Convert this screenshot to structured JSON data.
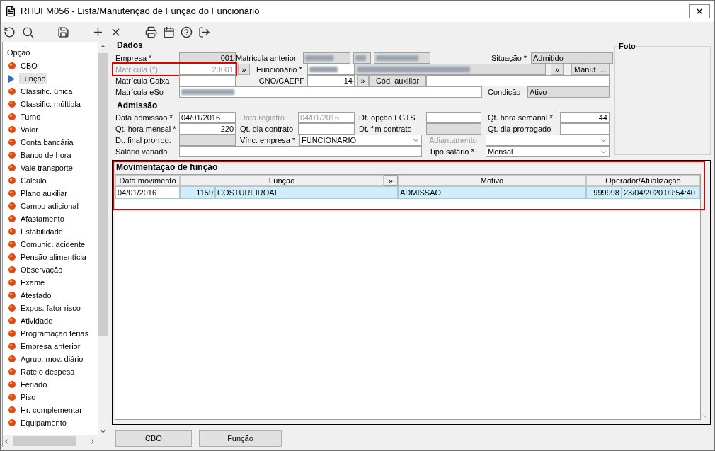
{
  "window": {
    "title": "RHUFM056 - Lista/Manutenção de Função do Funcionário"
  },
  "sidebar": {
    "header": "Opção",
    "items": [
      {
        "label": "CBO",
        "selected": false
      },
      {
        "label": "Função",
        "selected": true
      },
      {
        "label": "Classific. única",
        "selected": false
      },
      {
        "label": "Classific. múltipla",
        "selected": false
      },
      {
        "label": "Turno",
        "selected": false
      },
      {
        "label": "Valor",
        "selected": false
      },
      {
        "label": "Conta bancária",
        "selected": false
      },
      {
        "label": "Banco de hora",
        "selected": false
      },
      {
        "label": "Vale transporte",
        "selected": false
      },
      {
        "label": "Cálculo",
        "selected": false
      },
      {
        "label": "Plano auxiliar",
        "selected": false
      },
      {
        "label": "Campo adicional",
        "selected": false
      },
      {
        "label": "Afastamento",
        "selected": false
      },
      {
        "label": "Estabilidade",
        "selected": false
      },
      {
        "label": "Comunic. acidente",
        "selected": false
      },
      {
        "label": "Pensão alimentícia",
        "selected": false
      },
      {
        "label": "Observação",
        "selected": false
      },
      {
        "label": "Exame",
        "selected": false
      },
      {
        "label": "Atestado",
        "selected": false
      },
      {
        "label": "Expos. fator risco",
        "selected": false
      },
      {
        "label": "Atividade",
        "selected": false
      },
      {
        "label": "Programação férias",
        "selected": false
      },
      {
        "label": "Empresa anterior",
        "selected": false
      },
      {
        "label": "Agrup. mov. diário",
        "selected": false
      },
      {
        "label": "Rateio despesa",
        "selected": false
      },
      {
        "label": "Feriado",
        "selected": false
      },
      {
        "label": "Piso",
        "selected": false
      },
      {
        "label": "Hr. complementar",
        "selected": false
      },
      {
        "label": "Equipamento",
        "selected": false
      }
    ]
  },
  "dados": {
    "title": "Dados",
    "fields": [
      {
        "label": "Empresa *",
        "value": "001",
        "readonly": true,
        "disabled": false
      },
      {
        "label": "Matrícula anterior",
        "readonly": true,
        "masked": true,
        "disabled": false
      },
      {
        "label": "Situação *",
        "value": "Admitido",
        "readonly": true,
        "disabled": false
      },
      {
        "label": "Matrícula (*)",
        "value": "20001",
        "readonly": false,
        "disabled": true,
        "highlighted": true
      },
      {
        "label": "Funcionário *",
        "readonly": false,
        "masked": true,
        "disabled": false
      },
      {
        "label": "Matrícula Caixa",
        "readonly": false,
        "disabled": false
      },
      {
        "label": "CNO/CAEPF",
        "value": "14",
        "readonly": false,
        "disabled": false
      },
      {
        "label": "Matrícula eSo",
        "readonly": false,
        "masked": true,
        "disabled": false
      },
      {
        "label": "Condição",
        "value": "Ativo",
        "readonly": true,
        "disabled": false
      }
    ],
    "buttons": [
      "»",
      "»",
      "Manut. ...",
      "»",
      "Cód. auxiliar"
    ]
  },
  "admissao": {
    "title": "Admissão",
    "fields": [
      {
        "label": "Data admissão *",
        "value": "04/01/2016",
        "kind": "text",
        "readonly": false,
        "disabled": false
      },
      {
        "label": "Data registro",
        "value": "04/01/2016",
        "kind": "text",
        "readonly": false,
        "disabled": true
      },
      {
        "label": "Dt. opção FGTS",
        "kind": "text",
        "readonly": false,
        "disabled": false
      },
      {
        "label": "Qt. hora semanal *",
        "value": "44",
        "kind": "number",
        "readonly": false,
        "disabled": false
      },
      {
        "label": "Qt. hora mensal *",
        "value": "220",
        "kind": "number",
        "readonly": false,
        "disabled": false
      },
      {
        "label": "Qt. dia contrato",
        "kind": "text",
        "readonly": false,
        "disabled": false
      },
      {
        "label": "Dt. fim contrato",
        "kind": "text",
        "readonly": true,
        "disabled": false
      },
      {
        "label": "Qt. dia prorrogado",
        "kind": "text",
        "readonly": false,
        "disabled": false
      },
      {
        "label": "Dt. final prorrog.",
        "kind": "text",
        "readonly": true,
        "disabled": false
      },
      {
        "label": "Vínc. empresa *",
        "value": "FUNCIONARIO",
        "kind": "select",
        "readonly": false,
        "disabled": false
      },
      {
        "label": "Adiantamento",
        "kind": "select",
        "readonly": false,
        "disabled": true
      },
      {
        "label": "Salário variado",
        "kind": "text",
        "readonly": false,
        "disabled": false
      },
      {
        "label": "Tipo salário *",
        "value": "Mensal",
        "kind": "select",
        "readonly": false,
        "disabled": false
      }
    ]
  },
  "movimentacao": {
    "title": "Movimentação de função",
    "highlighted": true,
    "columns": [
      {
        "label": "Data movimento",
        "kind": "text"
      },
      {
        "label": "Função",
        "kind": "text"
      },
      {
        "label": "»",
        "kind": "button"
      },
      {
        "label": "Motivo",
        "kind": "text"
      },
      {
        "label": "Operador/Atualização",
        "kind": "text"
      }
    ],
    "rows": [
      {
        "selected": true,
        "cells": [
          "04/01/2016",
          "1159",
          "COSTUREIROAI",
          "ADMISSAO",
          "999998",
          "23/04/2020 09:54:40"
        ]
      }
    ]
  },
  "foto": {
    "title": "Foto"
  },
  "footer_buttons": [
    "CBO",
    "Função"
  ]
}
